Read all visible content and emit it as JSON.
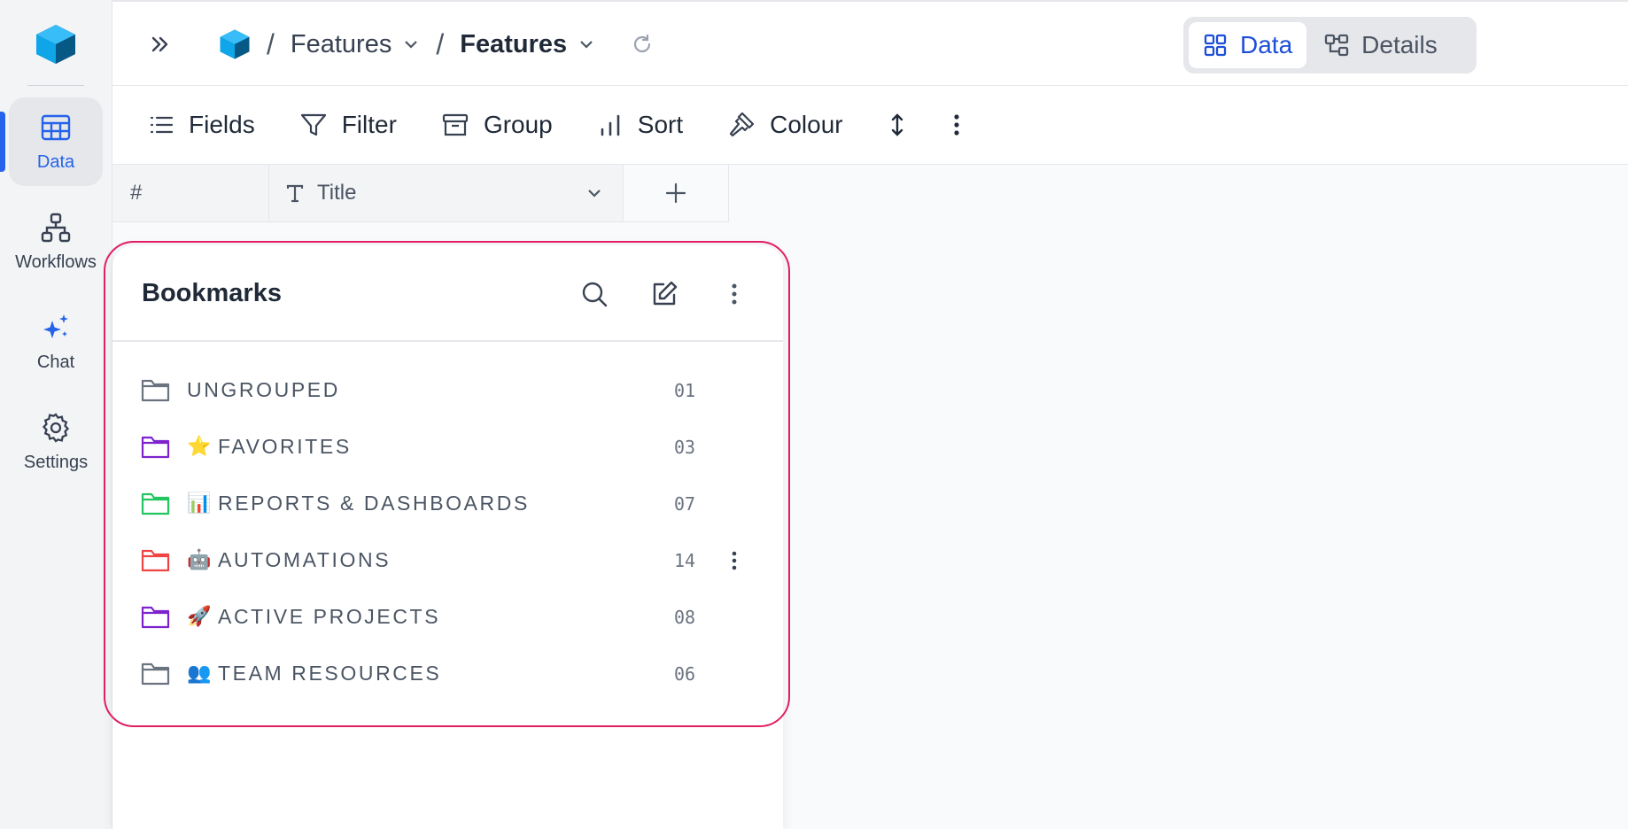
{
  "nav": {
    "items": [
      {
        "label": "Data",
        "icon": "table-icon",
        "active": true
      },
      {
        "label": "Workflows",
        "icon": "workflow-icon",
        "active": false
      },
      {
        "label": "Chat",
        "icon": "sparkles-icon",
        "active": false
      },
      {
        "label": "Settings",
        "icon": "gear-icon",
        "active": false
      }
    ]
  },
  "header": {
    "breadcrumbs": [
      "Features",
      "Features"
    ],
    "view_toggle": {
      "data_label": "Data",
      "details_label": "Details",
      "selected": "Data"
    }
  },
  "toolbar": {
    "fields_label": "Fields",
    "filter_label": "Filter",
    "group_label": "Group",
    "sort_label": "Sort",
    "colour_label": "Colour"
  },
  "grid": {
    "columns": [
      {
        "label": "#"
      },
      {
        "label": "Title",
        "type_icon": "text-type-icon"
      }
    ]
  },
  "bookmarks": {
    "title": "Bookmarks",
    "folders": [
      {
        "emoji": "",
        "label": "UNGROUPED",
        "count": "01",
        "color": "#6b7280"
      },
      {
        "emoji": "⭐",
        "label": "FAVORITES",
        "count": "03",
        "color": "#7e22ce"
      },
      {
        "emoji": "📊",
        "label": "REPORTS & DASHBOARDS",
        "count": "07",
        "color": "#22c55e"
      },
      {
        "emoji": "🤖",
        "label": "AUTOMATIONS",
        "count": "14",
        "color": "#ef4444"
      },
      {
        "emoji": "🚀",
        "label": "ACTIVE PROJECTS",
        "count": "08",
        "color": "#7e22ce"
      },
      {
        "emoji": "👥",
        "label": "TEAM RESOURCES",
        "count": "06",
        "color": "#6b7280"
      }
    ]
  },
  "colors": {
    "accent": "#2563eb",
    "highlight_outline": "#e11d63"
  }
}
